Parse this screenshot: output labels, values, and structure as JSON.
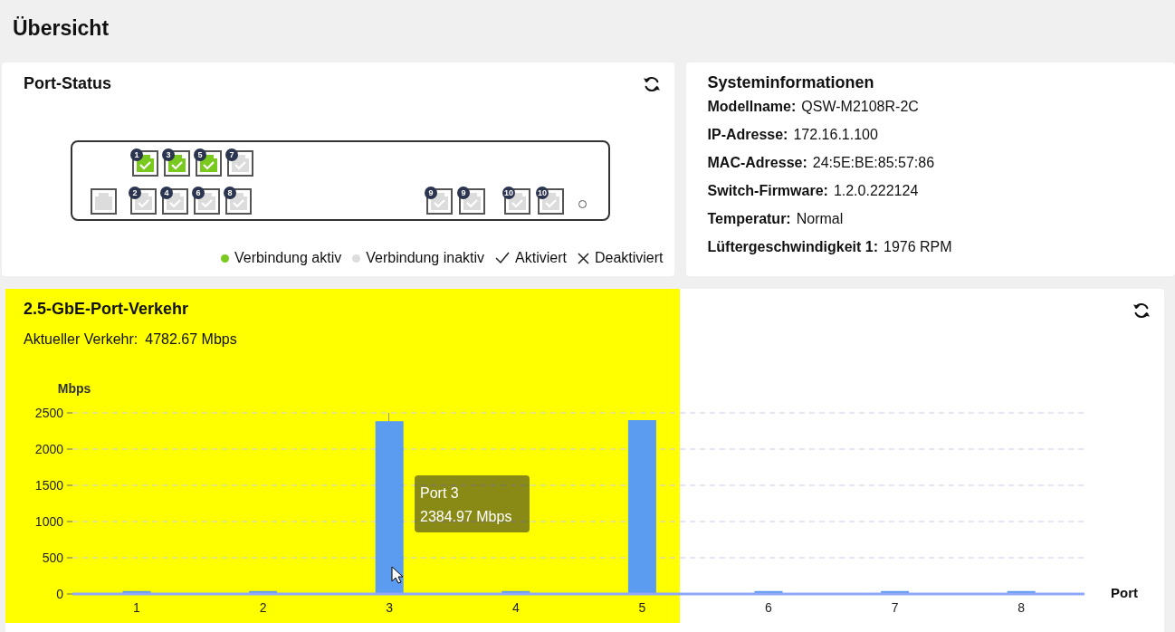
{
  "page_title": "Übersicht",
  "port_status": {
    "title": "Port-Status",
    "top_row": [
      {
        "kind": "rj45",
        "label": "1",
        "connected": true,
        "enabled": true
      },
      {
        "kind": "rj45",
        "label": "3",
        "connected": true,
        "enabled": true
      },
      {
        "kind": "rj45",
        "label": "5",
        "connected": true,
        "enabled": true
      },
      {
        "kind": "rj45",
        "label": "7",
        "connected": false,
        "enabled": true
      }
    ],
    "bottom_row": [
      {
        "kind": "console",
        "connected": false
      },
      {
        "kind": "rj45",
        "label": "2",
        "connected": false,
        "enabled": true
      },
      {
        "kind": "rj45",
        "label": "4",
        "connected": false,
        "enabled": true
      },
      {
        "kind": "rj45",
        "label": "6",
        "connected": false,
        "enabled": true
      },
      {
        "kind": "rj45",
        "label": "8",
        "connected": false,
        "enabled": true
      },
      {
        "kind": "rj45",
        "label": "9",
        "connected": false,
        "enabled": true
      },
      {
        "kind": "rj45",
        "label": "9",
        "connected": false,
        "enabled": true
      },
      {
        "kind": "rj45",
        "label": "10",
        "connected": false,
        "enabled": true
      },
      {
        "kind": "rj45",
        "label": "10",
        "connected": false,
        "enabled": true
      },
      {
        "kind": "led"
      }
    ],
    "legend": [
      {
        "kind": "dot",
        "color": "#7ac91f",
        "label": "Verbindung aktiv"
      },
      {
        "kind": "dot",
        "color": "#dddddd",
        "label": "Verbindung inaktiv"
      },
      {
        "kind": "check",
        "label": "Aktiviert"
      },
      {
        "kind": "cross",
        "label": "Deaktiviert"
      }
    ]
  },
  "system_info": {
    "title": "Systeminformationen",
    "rows": [
      {
        "label": "Modellname:",
        "value": "QSW-M2108R-2C"
      },
      {
        "label": "IP-Adresse:",
        "value": "172.16.1.100"
      },
      {
        "label": "MAC-Adresse:",
        "value": "24:5E:BE:85:57:86"
      },
      {
        "label": "Switch-Firmware:",
        "value": "1.2.0.222124"
      },
      {
        "label": "Temperatur:",
        "value": "Normal"
      },
      {
        "label": "Lüftergeschwindigkeit 1:",
        "value": "1976 RPM"
      }
    ]
  },
  "traffic": {
    "title": "2.5-GbE-Port-Verkehr",
    "current_label": "Aktueller Verkehr:",
    "current_value": "4782.67 Mbps",
    "highlighted": true,
    "tooltip": {
      "title": "Port 3",
      "value": "2384.97 Mbps"
    },
    "chart_data": {
      "type": "bar",
      "xlabel": "Port",
      "ylabel": "Mbps",
      "categories": [
        "1",
        "2",
        "3",
        "4",
        "5",
        "6",
        "7",
        "8"
      ],
      "series": [
        {
          "color": "#5b9bf0",
          "values": [
            40,
            40,
            2384.97,
            40,
            2400,
            40,
            40,
            40
          ]
        }
      ],
      "grid": true,
      "ylim": [
        0,
        2500
      ],
      "yticks": [
        0,
        500,
        1000,
        1500,
        2000,
        2500
      ]
    }
  }
}
